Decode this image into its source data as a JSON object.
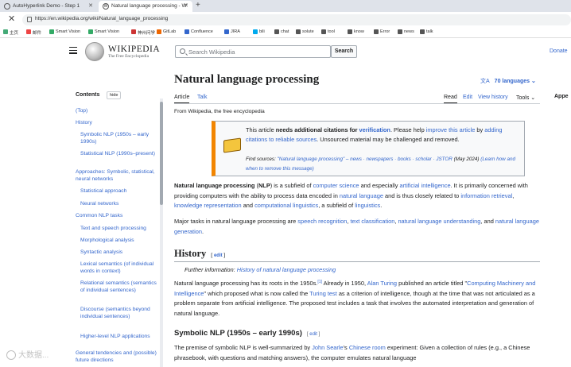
{
  "browser": {
    "tabs": [
      {
        "title": "AutoHyperlink Demo - Step 1"
      },
      {
        "title": "Natural language processing - W"
      }
    ],
    "new_tab": "+",
    "url": "https://en.wikipedia.org/wiki/Natural_language_processing",
    "bookmarks": [
      "主页",
      "邮件",
      "Smart Vision",
      "Smart Vision",
      "神州问学",
      "GitLab",
      "Confluence",
      "JIRA",
      "bili",
      "chat",
      "solute",
      "tool",
      "know",
      "Error",
      "news",
      "talk"
    ]
  },
  "header": {
    "wordmark": "WIKIPEDIA",
    "tagline": "The Free Encyclopedia",
    "search_placeholder": "Search Wikipedia",
    "search_button": "Search",
    "donate": "Donate"
  },
  "toc": {
    "title": "Contents",
    "hide": "hide",
    "items": [
      {
        "label": "(Top)",
        "level": 1
      },
      {
        "label": "History",
        "level": 1
      },
      {
        "label": "Symbolic NLP (1950s – early 1990s)",
        "level": 2
      },
      {
        "label": "Statistical NLP (1990s–present)",
        "level": 2
      },
      {
        "label": "Approaches: Symbolic, statistical, neural networks",
        "level": 1
      },
      {
        "label": "Statistical approach",
        "level": 2
      },
      {
        "label": "Neural networks",
        "level": 2
      },
      {
        "label": "Common NLP tasks",
        "level": 1
      },
      {
        "label": "Text and speech processing",
        "level": 2
      },
      {
        "label": "Morphological analysis",
        "level": 2
      },
      {
        "label": "Syntactic analysis",
        "level": 2
      },
      {
        "label": "Lexical semantics (of individual words in context)",
        "level": 2
      },
      {
        "label": "Relational semantics (semantics of individual sentences)",
        "level": 2
      },
      {
        "label": "Discourse (semantics beyond individual sentences)",
        "level": 2
      },
      {
        "label": "Higher-level NLP applications",
        "level": 2
      },
      {
        "label": "General tendencies and (possible) future directions",
        "level": 1
      }
    ]
  },
  "article": {
    "title": "Natural language processing",
    "languages": "70 languages",
    "tabs_left": [
      "Article",
      "Talk"
    ],
    "tabs_right": [
      "Read",
      "Edit",
      "View history",
      "Tools"
    ],
    "appearance": "Appe",
    "from": "From Wikipedia, the free encyclopedia",
    "notice": {
      "t1": "This article ",
      "t2": "needs additional citations for ",
      "t3": "verification",
      "t4": ". Please help ",
      "t5": "improve this article",
      "t6": " by ",
      "t7": "adding citations to reliable sources",
      "t8": ". Unsourced material may be challenged and removed.",
      "src1": "Find sources: ",
      "src2": "\"Natural language processing\" – news · newspapers · books · scholar · JSTOR",
      "src3": " (May 2024) ",
      "src4": "(Learn how and when to remove this message)"
    },
    "lead": {
      "a1": "Natural language processing",
      "a2": " (",
      "a3": "NLP",
      "a4": ") is a subfield of ",
      "a5": "computer science",
      "a6": " and especially ",
      "a7": "artificial intelligence",
      "a8": ". It is primarily concerned with providing computers with the ability to process data encoded in ",
      "a9": "natural language",
      "a10": " and is thus closely related to ",
      "a11": "information retrieval",
      "a12": ", ",
      "a13": "knowledge representation",
      "a14": " and ",
      "a15": "computational linguistics",
      "a16": ", a subfield of ",
      "a17": "linguistics",
      "a18": "."
    },
    "tasks": {
      "b1": "Major tasks in natural language processing are ",
      "b2": "speech recognition",
      "b3": ", ",
      "b4": "text classification",
      "b5": ", ",
      "b6": "natural language understanding",
      "b7": ", and ",
      "b8": "natural language generation",
      "b9": "."
    },
    "history": {
      "heading": "History",
      "edit": "edit",
      "hatnote_prefix": "Further information: ",
      "hatnote_link": "History of natural language processing",
      "c1": "Natural language processing has its roots in the 1950s.",
      "c2": "[1]",
      "c3": " Already in 1950, ",
      "c4": "Alan Turing",
      "c5": " published an article titled \"",
      "c6": "Computing Machinery and Intelligence",
      "c7": "\" which proposed what is now called the ",
      "c8": "Turing test",
      "c9": " as a criterion of intelligence, though at the time that was not articulated as a problem separate from artificial intelligence. The proposed test includes a task that involves the automated interpretation and generation of natural language."
    },
    "symbolic": {
      "heading": "Symbolic NLP (1950s – early 1990s)",
      "edit": "edit",
      "d1": "The premise of symbolic NLP is well-summarized by ",
      "d2": "John Searle",
      "d3": "'s ",
      "d4": "Chinese room",
      "d5": " experiment: Given a collection of rules (e.g., a Chinese phrasebook, with questions and matching answers), the computer emulates natural language"
    }
  },
  "watermark": "大数据..."
}
